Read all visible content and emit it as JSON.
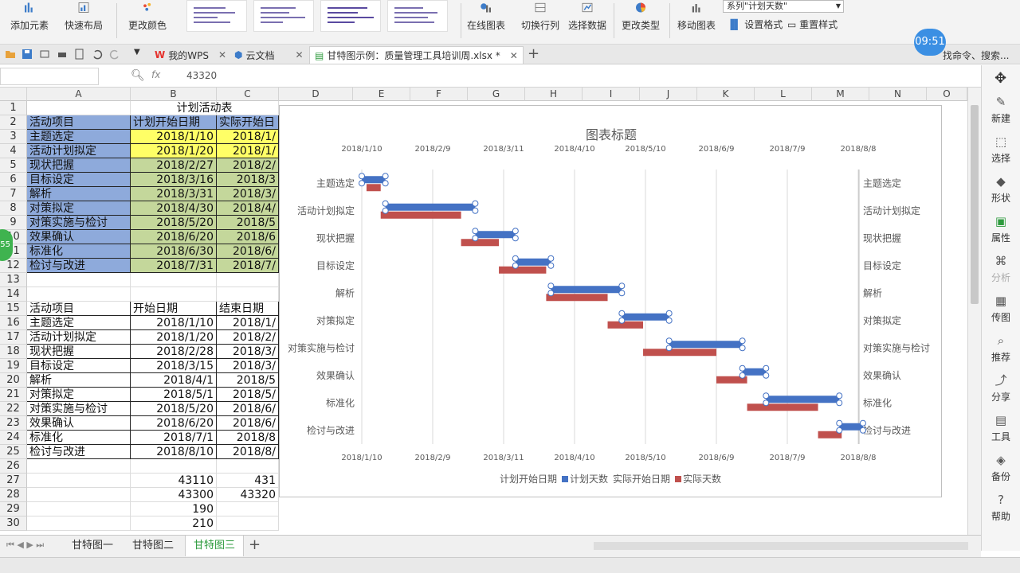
{
  "ribbon": {
    "add_element": "添加元素",
    "quick_layout": "快速布局",
    "change_color": "更改颜色",
    "online_chart": "在线图表",
    "switch_rowcol": "切换行列",
    "select_data": "选择数据",
    "change_type": "更改类型",
    "move_chart": "移动图表",
    "set_format": "设置格式",
    "reset_style": "重置样式",
    "series_select": "系列\"计划天数\""
  },
  "tabs": {
    "wps": "我的WPS",
    "cloud": "云文档",
    "file": "甘特图示例：质量管理工具培训周.xlsx *",
    "search": "找命令、搜索..."
  },
  "clock": "09:51",
  "badge": "55",
  "formula": {
    "fx": "fx",
    "value": "43320"
  },
  "columns": [
    "A",
    "B",
    "C",
    "D",
    "E",
    "F",
    "G",
    "H",
    "I",
    "J",
    "K",
    "L",
    "M",
    "N",
    "O"
  ],
  "rows": [
    "1",
    "2",
    "3",
    "4",
    "5",
    "6",
    "7",
    "8",
    "9",
    "10",
    "11",
    "12",
    "13",
    "14",
    "15",
    "16",
    "17",
    "18",
    "19",
    "20",
    "21",
    "22",
    "23",
    "24",
    "25",
    "26",
    "27",
    "28",
    "29",
    "30"
  ],
  "table1": {
    "title": "计划活动表",
    "headers": [
      "活动项目",
      "计划开始日期",
      "实际开始日"
    ],
    "rows": [
      [
        "主题选定",
        "2018/1/10",
        "2018/1/"
      ],
      [
        "活动计划拟定",
        "2018/1/20",
        "2018/1/"
      ],
      [
        "现状把握",
        "2018/2/27",
        "2018/2/"
      ],
      [
        "目标设定",
        "2018/3/16",
        "2018/3"
      ],
      [
        "解析",
        "2018/3/31",
        "2018/3/"
      ],
      [
        "对策拟定",
        "2018/4/30",
        "2018/4/"
      ],
      [
        "对策实施与检讨",
        "2018/5/20",
        "2018/5"
      ],
      [
        "效果确认",
        "2018/6/20",
        "2018/6"
      ],
      [
        "标准化",
        "2018/6/30",
        "2018/6/"
      ],
      [
        "检讨与改进",
        "2018/7/31",
        "2018/7/"
      ]
    ]
  },
  "table2": {
    "headers": [
      "活动项目",
      "开始日期",
      "结束日期"
    ],
    "rows": [
      [
        "主题选定",
        "2018/1/10",
        "2018/1/"
      ],
      [
        "活动计划拟定",
        "2018/1/20",
        "2018/2/"
      ],
      [
        "现状把握",
        "2018/2/28",
        "2018/3/"
      ],
      [
        "目标设定",
        "2018/3/15",
        "2018/3/"
      ],
      [
        "解析",
        "2018/4/1",
        "2018/5"
      ],
      [
        "对策拟定",
        "2018/5/1",
        "2018/5/"
      ],
      [
        "对策实施与检讨",
        "2018/5/20",
        "2018/6/"
      ],
      [
        "效果确认",
        "2018/6/20",
        "2018/6/"
      ],
      [
        "标准化",
        "2018/7/1",
        "2018/8"
      ],
      [
        "检讨与改进",
        "2018/8/10",
        "2018/8/"
      ]
    ]
  },
  "calc": [
    [
      "43110",
      "431"
    ],
    [
      "43300",
      "43320"
    ],
    [
      "190",
      ""
    ],
    [
      "210",
      ""
    ]
  ],
  "chart_data": {
    "type": "bar",
    "title": "图表标题",
    "x_ticks": [
      "2018/1/10",
      "2018/2/9",
      "2018/3/11",
      "2018/4/10",
      "2018/5/10",
      "2018/6/9",
      "2018/7/9",
      "2018/8/8"
    ],
    "categories": [
      "主题选定",
      "活动计划拟定",
      "现状把握",
      "目标设定",
      "解析",
      "对策拟定",
      "对策实施与检讨",
      "效果确认",
      "标准化",
      "检讨与改进"
    ],
    "series": [
      {
        "name": "计划天数",
        "color": "#4472c4",
        "start": [
          "2018/1/10",
          "2018/1/20",
          "2018/2/27",
          "2018/3/16",
          "2018/3/31",
          "2018/4/30",
          "2018/5/20",
          "2018/6/20",
          "2018/6/30",
          "2018/7/31"
        ],
        "end": [
          "2018/1/20",
          "2018/2/27",
          "2018/3/16",
          "2018/3/31",
          "2018/4/30",
          "2018/5/20",
          "2018/6/20",
          "2018/6/30",
          "2018/7/31",
          "2018/8/10"
        ]
      },
      {
        "name": "实际天数",
        "color": "#c0504d",
        "start": [
          "2018/1/12",
          "2018/1/18",
          "2018/2/21",
          "2018/3/9",
          "2018/3/29",
          "2018/4/24",
          "2018/5/9",
          "2018/6/9",
          "2018/6/22",
          "2018/7/22"
        ],
        "end": [
          "2018/1/18",
          "2018/2/21",
          "2018/3/9",
          "2018/3/29",
          "2018/4/24",
          "2018/5/9",
          "2018/6/9",
          "2018/6/22",
          "2018/7/22",
          "2018/8/1"
        ]
      }
    ],
    "legend": [
      "计划开始日期",
      "计划天数",
      "实际开始日期",
      "实际天数"
    ],
    "legend_position": "bottom",
    "grid": true
  },
  "right_panel": [
    "新建",
    "选择",
    "形状",
    "属性",
    "分析",
    "传图",
    "推荐",
    "分享",
    "工具",
    "备份",
    "帮助"
  ],
  "sheet_tabs": [
    "甘特图一",
    "甘特图二",
    "甘特图三"
  ],
  "colors": {
    "blue_fill": "#8eaadb",
    "yellow_fill": "#ffff66",
    "green_fill": "#c4d79b"
  }
}
